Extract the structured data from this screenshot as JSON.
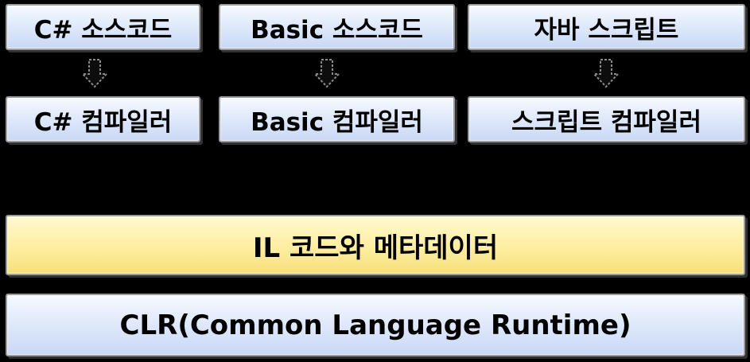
{
  "colors": {
    "background": "#000000",
    "language_box": "#dfe8fa",
    "il_box": "#fdeea0",
    "clr_box": "#dfe8fa",
    "border": "#9a9a9a"
  },
  "sources": [
    {
      "label": "C# 소스코드"
    },
    {
      "label": "Basic 소스코드"
    },
    {
      "label": "자바 스크립트"
    }
  ],
  "compilers": [
    {
      "label": "C# 컴파일러"
    },
    {
      "label": "Basic 컴파일러"
    },
    {
      "label": "스크립트 컴파일러"
    }
  ],
  "arrows": [
    {
      "icon": "arrow-down-icon"
    },
    {
      "icon": "arrow-down-icon"
    },
    {
      "icon": "arrow-down-icon"
    }
  ],
  "il": {
    "label": "IL 코드와 메타데이터"
  },
  "clr": {
    "label": "CLR(Common Language Runtime)"
  }
}
